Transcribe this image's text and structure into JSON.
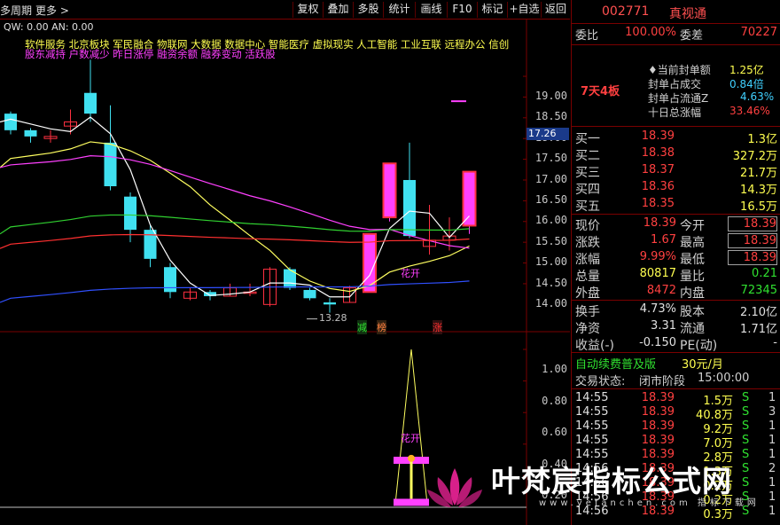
{
  "toolbar": {
    "left_items": [
      "多周期",
      "更多 >"
    ],
    "buttons": [
      "复权",
      "叠加",
      "多股",
      "统计",
      "画线",
      "F10",
      "标记",
      "+自选",
      "返回"
    ]
  },
  "chart": {
    "qw_line": "QW: 0.00  AN: 0.00",
    "sector_line1": "软件服务  北京板块  军民融合 物联网 大数据 数据中心 智能医疗 虚拟现实 人工智能 工业互联 远程办公 信创",
    "sector_line2": "股东减持 户数减少 昨日涨停 融资余额 融券变动 活跃股",
    "current_price_tag": "17.26",
    "low_marker": "13.28",
    "flower_label": "花开",
    "signal_labels": [
      {
        "text": "减",
        "color": "#30e030"
      },
      {
        "text": "榜",
        "color": "#ff8040"
      },
      {
        "text": "涨",
        "color": "#ff3030"
      }
    ],
    "price_axis": [
      19.0,
      18.5,
      18.0,
      17.5,
      17.0,
      16.5,
      16.0,
      15.5,
      15.0,
      14.5,
      14.0
    ],
    "price_range": [
      13.4,
      19.3
    ],
    "indicator_axis": [
      "1.00",
      "0.80",
      "0.60",
      "0.40",
      "0.20"
    ],
    "candles": [
      {
        "o": 17.7,
        "c": 18.1,
        "h": 18.15,
        "l": 17.6,
        "up": false
      },
      {
        "o": 17.7,
        "c": 17.55,
        "h": 17.75,
        "l": 17.4,
        "up": false
      },
      {
        "o": 17.5,
        "c": 17.55,
        "h": 17.7,
        "l": 17.4,
        "up": true
      },
      {
        "o": 17.8,
        "c": 17.9,
        "h": 18.2,
        "l": 17.6,
        "up": true
      },
      {
        "o": 18.1,
        "c": 18.6,
        "h": 19.4,
        "l": 17.9,
        "up": false
      },
      {
        "o": 17.4,
        "c": 16.35,
        "h": 18.3,
        "l": 16.25,
        "up": false
      },
      {
        "o": 16.1,
        "c": 15.3,
        "h": 16.2,
        "l": 15.0,
        "up": false
      },
      {
        "o": 15.3,
        "c": 14.6,
        "h": 15.4,
        "l": 14.4,
        "up": false
      },
      {
        "o": 14.4,
        "c": 13.8,
        "h": 14.5,
        "l": 13.65,
        "up": false
      },
      {
        "o": 13.8,
        "c": 13.65,
        "h": 13.9,
        "l": 13.6,
        "up": true
      },
      {
        "o": 13.8,
        "c": 13.7,
        "h": 13.85,
        "l": 13.6,
        "up": false
      },
      {
        "o": 13.7,
        "c": 13.9,
        "h": 14.0,
        "l": 13.7,
        "up": true
      },
      {
        "o": 13.8,
        "c": 13.8,
        "h": 14.0,
        "l": 13.7,
        "up": true
      },
      {
        "o": 13.5,
        "c": 14.35,
        "h": 14.4,
        "l": 13.45,
        "up": true
      },
      {
        "o": 14.35,
        "c": 13.9,
        "h": 14.4,
        "l": 13.85,
        "up": false
      },
      {
        "o": 13.85,
        "c": 13.65,
        "h": 13.9,
        "l": 13.6,
        "up": false
      },
      {
        "o": 13.55,
        "c": 13.5,
        "h": 13.65,
        "l": 13.3,
        "up": false
      },
      {
        "o": 13.55,
        "c": 13.9,
        "h": 13.95,
        "l": 13.55,
        "up": true
      },
      {
        "o": 13.8,
        "c": 15.2,
        "h": 15.2,
        "l": 13.8,
        "up": true
      },
      {
        "o": 15.6,
        "c": 16.9,
        "h": 16.9,
        "l": 15.5,
        "up": true
      },
      {
        "o": 16.5,
        "c": 15.15,
        "h": 17.4,
        "l": 15.1,
        "up": false
      },
      {
        "o": 14.9,
        "c": 15.05,
        "h": 15.9,
        "l": 14.7,
        "up": true
      },
      {
        "o": 15.05,
        "c": 15.15,
        "h": 15.6,
        "l": 14.8,
        "up": true
      },
      {
        "o": 15.4,
        "c": 16.7,
        "h": 16.7,
        "l": 15.2,
        "up": true
      }
    ]
  },
  "info": {
    "code": "002771",
    "name": "真视通",
    "weibi_label": "委比",
    "weibi_value": "100.00%",
    "weicha_label": "委差",
    "weicha_value": "70227",
    "board_label": "7天4板",
    "seal_rows": [
      {
        "label": "当前封单额",
        "value": "1.25亿"
      },
      {
        "label": "封单占成交",
        "value": "0.84倍"
      },
      {
        "label": "封单占流通Z",
        "value": "4.63%"
      },
      {
        "label": "十日总涨幅",
        "value": "33.46%"
      }
    ],
    "bids": [
      {
        "label": "买一",
        "price": "18.39",
        "vol": "1.3亿"
      },
      {
        "label": "买二",
        "price": "18.38",
        "vol": "327.2万"
      },
      {
        "label": "买三",
        "price": "18.37",
        "vol": "21.7万"
      },
      {
        "label": "买四",
        "price": "18.36",
        "vol": "14.3万"
      },
      {
        "label": "买五",
        "price": "18.35",
        "vol": "16.5万"
      }
    ],
    "quote": [
      {
        "l1": "现价",
        "v1": "18.39",
        "c1": "red",
        "l2": "今开",
        "v2": "18.39",
        "c2": "red",
        "box": true
      },
      {
        "l1": "涨跌",
        "v1": "1.67",
        "c1": "red",
        "l2": "最高",
        "v2": "18.39",
        "c2": "red",
        "box": true
      },
      {
        "l1": "涨幅",
        "v1": "9.99%",
        "c1": "red",
        "l2": "最低",
        "v2": "18.39",
        "c2": "red",
        "box": true
      },
      {
        "l1": "总量",
        "v1": "80817",
        "c1": "yellow",
        "l2": "量比",
        "v2": "0.21",
        "c2": "green",
        "box": false
      },
      {
        "l1": "外盘",
        "v1": "8472",
        "c1": "red",
        "l2": "内盘",
        "v2": "72345",
        "c2": "green",
        "box": false
      }
    ],
    "stats": [
      {
        "l1": "换手",
        "v1": "4.73%",
        "l2": "股本",
        "v2": "2.10亿"
      },
      {
        "l1": "净资",
        "v1": "3.31",
        "l2": "流通",
        "v2": "1.71亿"
      },
      {
        "l1": "收益(-)",
        "v1": "-0.150",
        "l2": "PE(动)",
        "v2": "-"
      }
    ],
    "promo": "自动续费普及版",
    "promo_price": "30元/月",
    "trade_state_label": "交易状态:",
    "trade_state": "闭市阶段",
    "trade_time": "15:00:00",
    "ticks": [
      {
        "time": "14:55",
        "price": "18.39",
        "vol": "1.5万",
        "side": "S",
        "n": "1"
      },
      {
        "time": "14:55",
        "price": "18.39",
        "vol": "40.8万",
        "side": "S",
        "n": "3"
      },
      {
        "time": "14:55",
        "price": "18.39",
        "vol": "9.2万",
        "side": "S",
        "n": "1"
      },
      {
        "time": "14:55",
        "price": "18.39",
        "vol": "7.0万",
        "side": "S",
        "n": "1"
      },
      {
        "time": "14:55",
        "price": "18.39",
        "vol": "2.8万",
        "side": "S",
        "n": "1"
      },
      {
        "time": "14:56",
        "price": "18.39",
        "vol": "1.3万",
        "side": "S",
        "n": "2"
      },
      {
        "time": "14:56",
        "price": "18.39",
        "vol": "0.2万",
        "side": "S",
        "n": "1"
      },
      {
        "time": "14:56",
        "price": "18.39",
        "vol": "0.2万",
        "side": "S",
        "n": "1"
      },
      {
        "time": "14:56",
        "price": "18.39",
        "vol": "0.3万",
        "side": "S",
        "n": "1"
      }
    ]
  },
  "watermark": {
    "text": "叶梵宸指标公式网",
    "sub": "www.yefanchen.com  指标下载网"
  }
}
